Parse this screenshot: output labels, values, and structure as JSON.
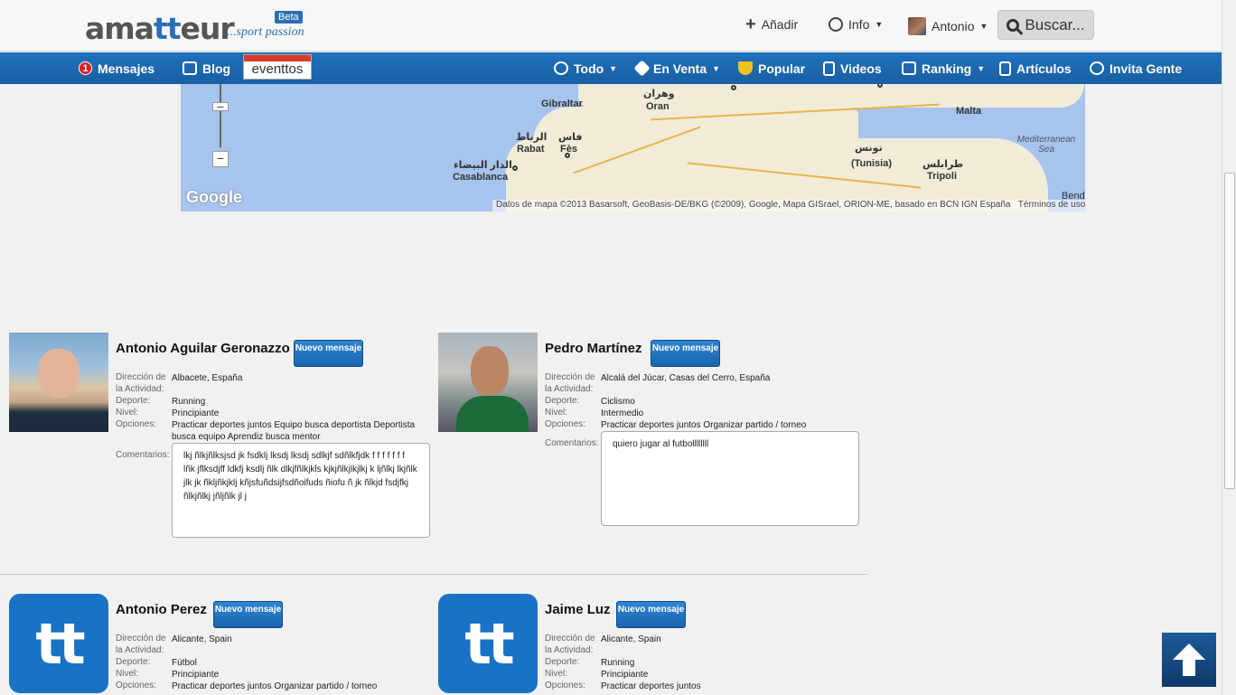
{
  "header": {
    "logo_main_a": "ama",
    "logo_main_b": "tt",
    "logo_main_c": "eur",
    "logo_tagline": "...sport passion",
    "logo_badge": "Beta",
    "add_label": "Añadir",
    "info_label": "Info",
    "user_label": "Antonio",
    "search_label": "Buscar..."
  },
  "nav": {
    "messages_count": "1",
    "messages_label": "Mensajes",
    "blog_label": "Blog",
    "eventtos_label": "eventtos",
    "todo_label": "Todo",
    "en_venta_label": "En Venta",
    "popular_label": "Popular",
    "videos_label": "Videos",
    "ranking_label": "Ranking",
    "articulos_label": "Artículos",
    "invita_label": "Invita Gente"
  },
  "map": {
    "labels": {
      "gibraltar": "Gibraltar",
      "oran_ar": "وهران",
      "oran": "Oran",
      "rabat_ar": "الرباط",
      "rabat": "Rabat",
      "fes_ar": "فاس",
      "fes": "Fès",
      "casablanca_ar": "الدار البيضاء",
      "casablanca": "Casablanca",
      "tunis_ar": "تونس",
      "tunis": "(Tunisia)",
      "tripoli_ar": "طرابلس",
      "tripoli": "Tripoli",
      "malta": "Malta",
      "sea": "Mediterranean Sea",
      "bend": "Bend"
    },
    "google": "Google",
    "attribution": "Datos de mapa ©2013 Basarsoft, GeoBasis-DE/BKG (©2009), Google, Mapa GISrael, ORION-ME, basado en BCN IGN España",
    "terms": "Términos de uso",
    "zoom_in": "−",
    "zoom_out": "−"
  },
  "labels": {
    "direccion": "Dirección de",
    "actividad": "la Actividad:",
    "deporte": "Deporte:",
    "nivel": "Nivel:",
    "opciones": "Opciones:",
    "comentarios": "Comentarios:",
    "nuevo_mensaje": "Nuevo mensaje"
  },
  "profiles": [
    {
      "name": "Antonio Aguilar Geronazzo",
      "direccion": "Albacete, España",
      "deporte": "Running",
      "nivel": "Principiante",
      "opciones": "Practicar deportes juntos Equipo busca deportista Deportista busca equipo Aprendiz busca mentor",
      "comentarios": "lkj ñlkjñlksjsd jk fsdklj lksdj lksdj sdlkjf sdñlkfjdk f f f f f f f lñk jflksdjff ldkfj ksdlj ñlk dlkjfñlkjkls kjkjñlkjlkjlkj k ljñlkj lkjñlk jlk jk ñkljñkjklj kñjsfuñdsijfsdñoifuds ñiofu ñ jk ñlkjd fsdjfkj ñlkjñlkj jñljñlk jl j"
    },
    {
      "name": "Pedro Martínez",
      "direccion": "Alcalá del Júcar, Casas del Cerro, España",
      "deporte": "Ciclismo",
      "nivel": "Intermedio",
      "opciones": "Practicar deportes juntos Organizar partido / torneo",
      "comentarios": "quiero jugar al futbollllllll"
    },
    {
      "name": "Antonio Perez",
      "direccion": "Alicante, Spain",
      "deporte": "Fútbol",
      "nivel": "Principiante",
      "opciones": "Practicar deportes juntos Organizar partido / torneo"
    },
    {
      "name": "Jaime Luz",
      "direccion": "Alicante, Spain",
      "deporte": "Running",
      "nivel": "Principiante",
      "opciones": "Practicar deportes juntos"
    }
  ],
  "tt_logo_text": "tt"
}
